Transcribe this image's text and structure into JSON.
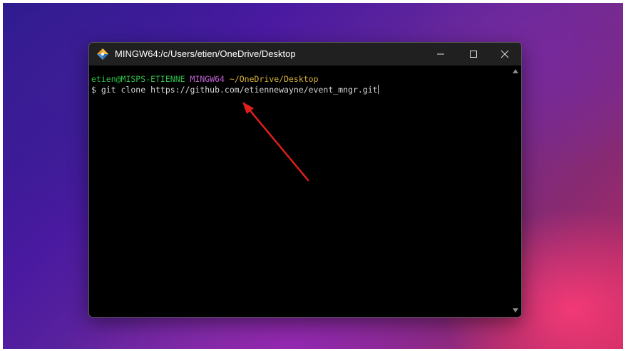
{
  "window": {
    "title": "MINGW64:/c/Users/etien/OneDrive/Desktop",
    "controls": {
      "minimize_icon": "minimize-icon",
      "maximize_icon": "maximize-icon",
      "close_icon": "close-icon"
    }
  },
  "terminal": {
    "prompt": {
      "user_host": "etien@MISPS-ETIENNE",
      "system": "MINGW64",
      "path": "~/OneDrive/Desktop"
    },
    "command_line": "$ git clone https://github.com/etiennewayne/event_mngr.git"
  },
  "colors": {
    "prompt_user_host": "#2fc04a",
    "prompt_system": "#c060d0",
    "prompt_path": "#d6b03a",
    "command_text": "#d8d8d8",
    "annotation_arrow": "#e0201a",
    "titlebar": "#202020"
  },
  "annotation": {
    "type": "arrow",
    "icon": "red-arrow-annotation"
  }
}
